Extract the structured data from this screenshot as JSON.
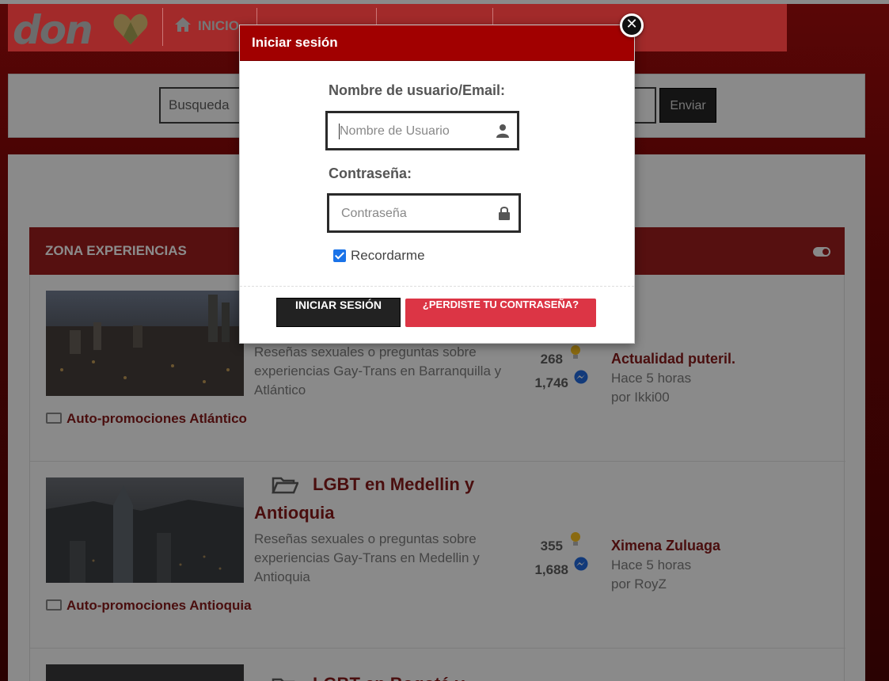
{
  "header": {
    "logo": "don",
    "nav": [
      {
        "label": "INICIO"
      },
      {
        "label": ""
      },
      {
        "label": ""
      },
      {
        "label": ""
      }
    ]
  },
  "search": {
    "placeholder": "Busqueda",
    "button_label": "Enviar"
  },
  "zone": {
    "title": "ZONA EXPERIENCIAS",
    "forums": [
      {
        "title": "",
        "description": "Reseñas sexuales o preguntas sobre experiencias Gay-Trans en Barranquilla y Atlántico",
        "topics": "268",
        "posts": "1,746",
        "last_title": "Actualidad puteril.",
        "last_time": "Hace 5 horas",
        "last_by": "por Ikki00",
        "subforum": "Auto-promociones Atlántico"
      },
      {
        "title": "LGBT en Medellin y Antioquia",
        "description": "Reseñas sexuales o preguntas sobre experiencias Gay-Trans en Medellin y Antioquia",
        "topics": "355",
        "posts": "1,688",
        "last_title": "Ximena Zuluaga",
        "last_time": "Hace 5 horas",
        "last_by": "por RoyZ",
        "subforum": "Auto-promociones Antioquia"
      },
      {
        "title": "LGBT en Bogotá y"
      }
    ]
  },
  "modal": {
    "title": "Iniciar sesión",
    "username_label": "Nombre de usuario/Email:",
    "username_placeholder": "Nombre de Usuario",
    "password_label": "Contraseña:",
    "password_placeholder": "Contraseña",
    "remember_label": "Recordarme",
    "remember_checked": true,
    "login_button": "INICIAR SESIÓN",
    "forgot_button": "¿PERDISTE TU CONTRASEÑA?",
    "close_icon": "close-icon"
  },
  "colors": {
    "modal_header": "#a10000",
    "forgot_button": "#dc3545",
    "login_button": "#222222",
    "checkbox": "#1a73e8"
  }
}
